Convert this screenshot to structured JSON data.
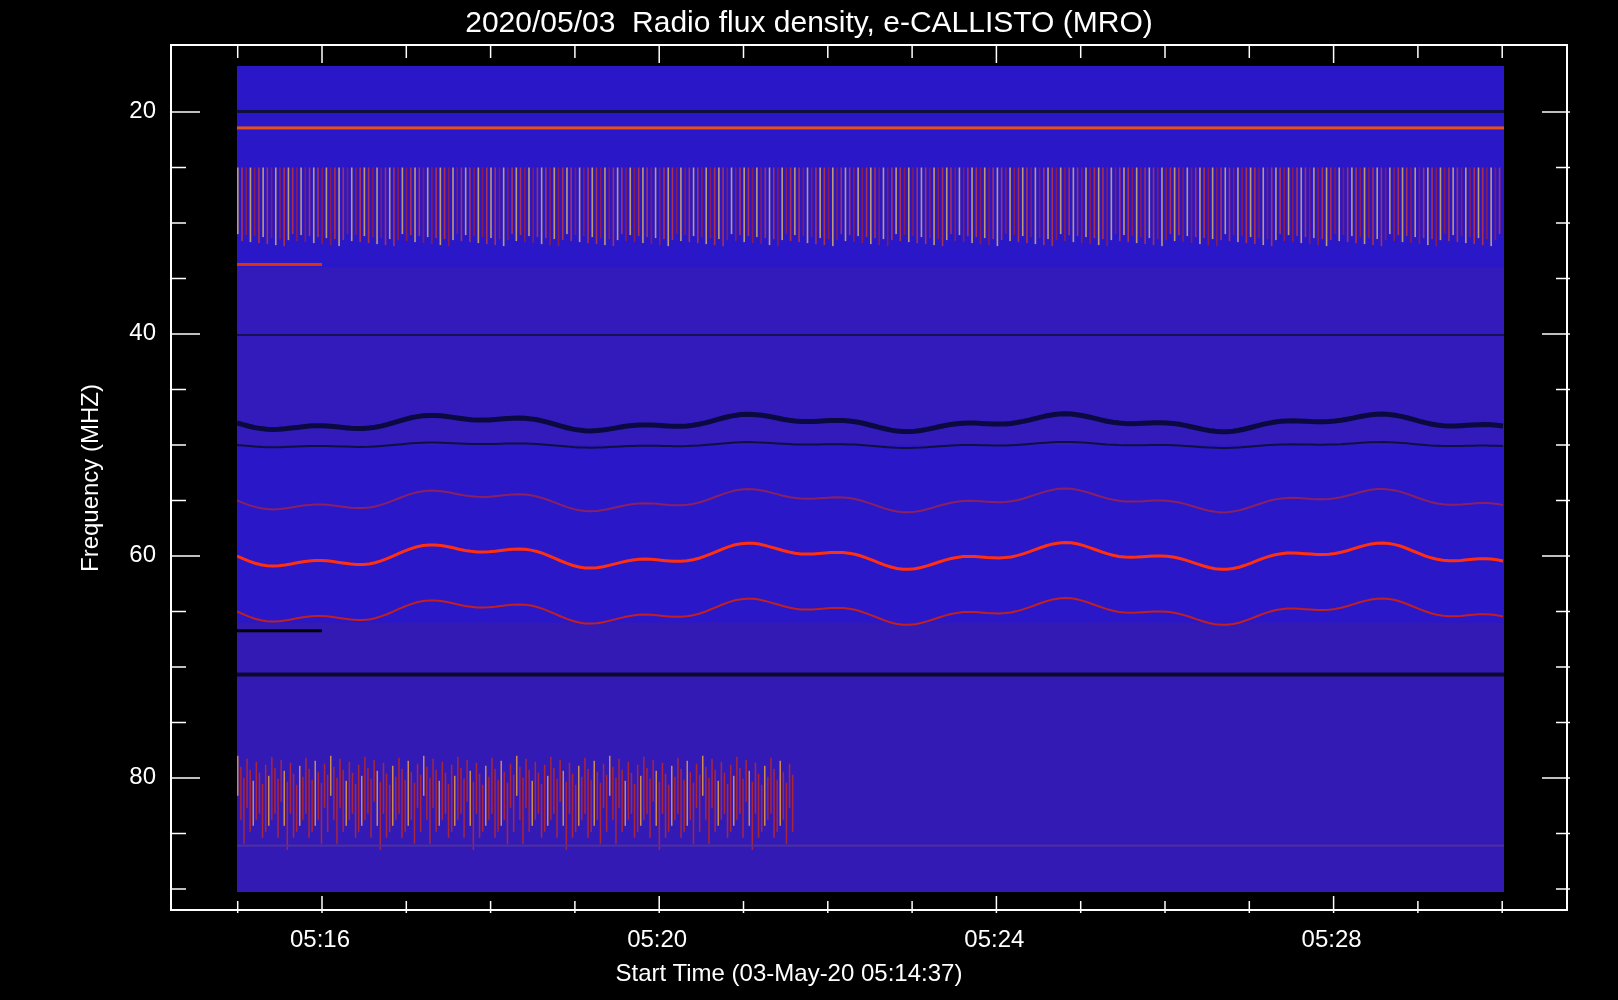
{
  "title": "2020/05/03  Radio flux density, e-CALLISTO (MRO)",
  "y_axis": {
    "label": "Frequency (MHZ)",
    "ticks": [
      "20",
      "40",
      "60",
      "80"
    ]
  },
  "x_axis": {
    "label": "Start Time (03-May-20 05:14:37)",
    "ticks": [
      "05:16",
      "05:20",
      "05:24",
      "05:28"
    ]
  }
}
